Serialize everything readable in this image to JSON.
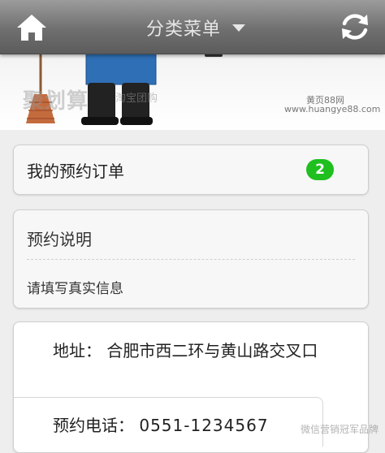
{
  "header": {
    "menu_title": "分类菜单",
    "home_icon": "home-icon",
    "refresh_icon": "refresh-icon",
    "background_color": "#6f6f6f"
  },
  "banner": {
    "watermark_main": "聚划算",
    "watermark_sub": "淘宝团购",
    "watermark_sub_url": "taobao.com",
    "site_name": "黄页88网",
    "site_url": "www.huangye88.com"
  },
  "orders": {
    "label": "我的预约订单",
    "count": "2",
    "badge_color": "#1fbf1f"
  },
  "info": {
    "title": "预约说明",
    "text": "请填写真实信息"
  },
  "contact": {
    "address_label": "地址：",
    "address_value": "合肥市西二环与黄山路交叉口",
    "phone_label": "预约电话：",
    "phone_value": "0551-1234567"
  },
  "corner_watermark": "微信营销冠军品牌"
}
